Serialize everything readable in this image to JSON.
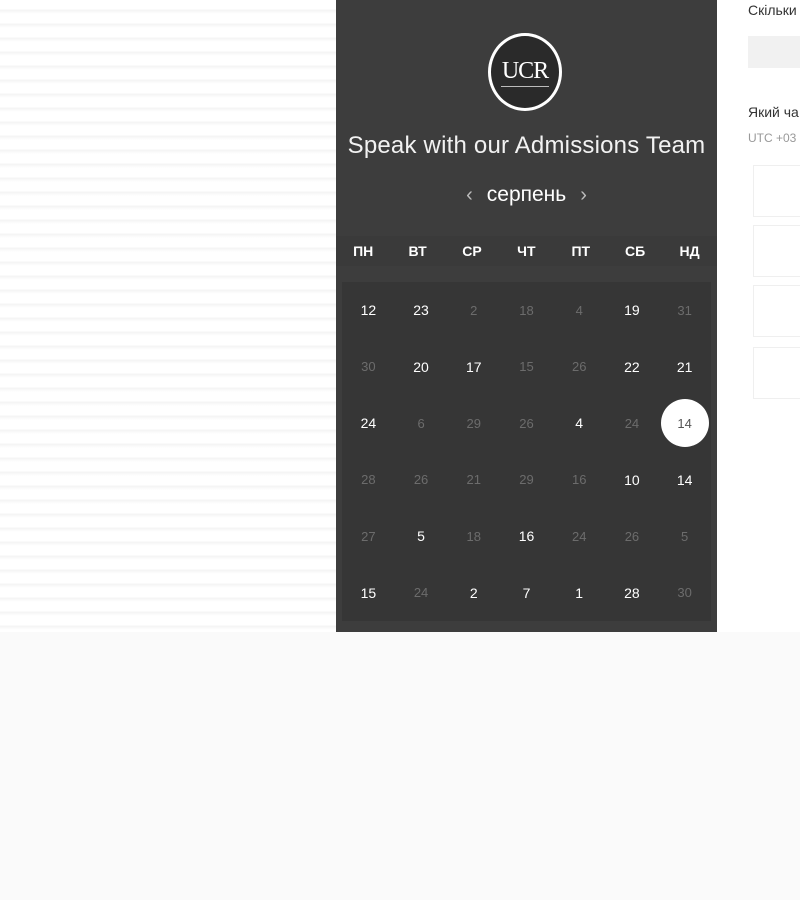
{
  "calendar": {
    "logo_text": "UCR",
    "title": "Speak with our Admissions Team",
    "month": "серпень",
    "prev_icon": "‹",
    "next_icon": "›",
    "weekdays": [
      "ПН",
      "ВТ",
      "СР",
      "ЧТ",
      "ПТ",
      "СБ",
      "НД"
    ],
    "weeks": [
      [
        {
          "d": "12",
          "m": false
        },
        {
          "d": "23",
          "m": false
        },
        {
          "d": "2",
          "m": true
        },
        {
          "d": "18",
          "m": true
        },
        {
          "d": "4",
          "m": true
        },
        {
          "d": "19",
          "m": false
        },
        {
          "d": "31",
          "m": true
        }
      ],
      [
        {
          "d": "30",
          "m": true
        },
        {
          "d": "20",
          "m": false
        },
        {
          "d": "17",
          "m": false
        },
        {
          "d": "15",
          "m": true
        },
        {
          "d": "26",
          "m": true
        },
        {
          "d": "22",
          "m": false
        },
        {
          "d": "21",
          "m": false
        }
      ],
      [
        {
          "d": "24",
          "m": false
        },
        {
          "d": "6",
          "m": true
        },
        {
          "d": "29",
          "m": true
        },
        {
          "d": "26",
          "m": true
        },
        {
          "d": "4",
          "m": false
        },
        {
          "d": "24",
          "m": true
        },
        {
          "d": "14",
          "m": false,
          "selected": true
        }
      ],
      [
        {
          "d": "28",
          "m": true
        },
        {
          "d": "26",
          "m": true
        },
        {
          "d": "21",
          "m": true
        },
        {
          "d": "29",
          "m": true
        },
        {
          "d": "16",
          "m": true
        },
        {
          "d": "10",
          "m": false
        },
        {
          "d": "14",
          "m": false
        }
      ],
      [
        {
          "d": "27",
          "m": true
        },
        {
          "d": "5",
          "m": false
        },
        {
          "d": "18",
          "m": true
        },
        {
          "d": "16",
          "m": false
        },
        {
          "d": "24",
          "m": true
        },
        {
          "d": "26",
          "m": true
        },
        {
          "d": "5",
          "m": true
        }
      ],
      [
        {
          "d": "15",
          "m": false
        },
        {
          "d": "24",
          "m": true
        },
        {
          "d": "2",
          "m": false
        },
        {
          "d": "7",
          "m": false
        },
        {
          "d": "1",
          "m": false
        },
        {
          "d": "28",
          "m": false
        },
        {
          "d": "30",
          "m": true
        }
      ]
    ]
  },
  "form": {
    "count_label": "Скільки",
    "time_label": "Який ча",
    "timezone": "UTC +03"
  }
}
